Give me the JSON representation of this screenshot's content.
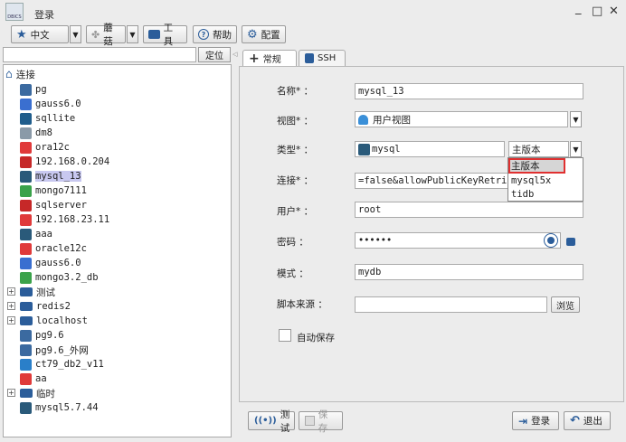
{
  "window": {
    "title": "登录",
    "app_icon_text": "DBICS",
    "minimize": "_",
    "maximize": "□",
    "close": "✕"
  },
  "toolbar": {
    "language": "中文",
    "theme": "蘑菇",
    "tools": "工具",
    "help": "帮助",
    "config": "配置"
  },
  "left": {
    "search_value": "",
    "locate": "定位"
  },
  "tree": {
    "root": "连接",
    "items": [
      {
        "label": "pg",
        "icon": "postgres-icon"
      },
      {
        "label": "gauss6.0",
        "icon": "gauss-icon"
      },
      {
        "label": "sqllite",
        "icon": "sqlite-icon"
      },
      {
        "label": "dm8",
        "icon": "dm-icon"
      },
      {
        "label": "ora12c",
        "icon": "oracle-icon"
      },
      {
        "label": "192.168.0.204",
        "icon": "sqlserver-icon"
      },
      {
        "label": "mysql_13",
        "icon": "mysql-icon"
      },
      {
        "label": "mongo7111",
        "icon": "mongo-icon"
      },
      {
        "label": "sqlserver",
        "icon": "sqlserver-icon"
      },
      {
        "label": "192.168.23.11",
        "icon": "oracle-icon"
      },
      {
        "label": "aaa",
        "icon": "mysql-icon"
      },
      {
        "label": "oracle12c",
        "icon": "oracle-icon"
      },
      {
        "label": "gauss6.0",
        "icon": "gauss-icon"
      },
      {
        "label": "mongo3.2_db",
        "icon": "mongo-icon"
      },
      {
        "label": "测试",
        "icon": "folder-icon"
      },
      {
        "label": "redis2",
        "icon": "folder-icon"
      },
      {
        "label": "localhost",
        "icon": "folder-icon"
      },
      {
        "label": "pg9.6",
        "icon": "postgres-icon"
      },
      {
        "label": "pg9.6_外网",
        "icon": "postgres-icon"
      },
      {
        "label": "ct79_db2_v11",
        "icon": "db2-icon"
      },
      {
        "label": "aa",
        "icon": "oracle-icon"
      },
      {
        "label": "临时",
        "icon": "folder-icon"
      },
      {
        "label": "mysql5.7.44",
        "icon": "mysql-icon"
      }
    ]
  },
  "tabs": {
    "general": "常规",
    "ssh": "SSH"
  },
  "form": {
    "name_label": "名称* ：",
    "name_value": "mysql_13",
    "view_label": "视图* ：",
    "view_value": "用户视图",
    "type_label": "类型* ：",
    "type_value": "mysql",
    "version_value": "主版本",
    "version_options": [
      "主版本",
      "mysql5x",
      "tidb"
    ],
    "conn_label": "连接* ：",
    "conn_value": "=false&allowPublicKeyRetriev",
    "user_label": "用户* ：",
    "user_value": "root",
    "pwd_label": "密码 ：",
    "pwd_value": "••••••",
    "schema_label": "模式 ：",
    "schema_value": "mydb",
    "script_label": "脚本来源 ：",
    "script_value": "",
    "browse": "浏览",
    "autosave": "自动保存"
  },
  "bottom": {
    "test": "测试",
    "save": "保存",
    "login": "登录",
    "exit": "退出"
  },
  "colors": {
    "oracle": "#e03a3a",
    "mysql": "#2a5a7a",
    "mongo": "#3aa24a",
    "gauss": "#3a6fd0",
    "folder": "#2b5d9a",
    "highlight": "#e03030"
  }
}
